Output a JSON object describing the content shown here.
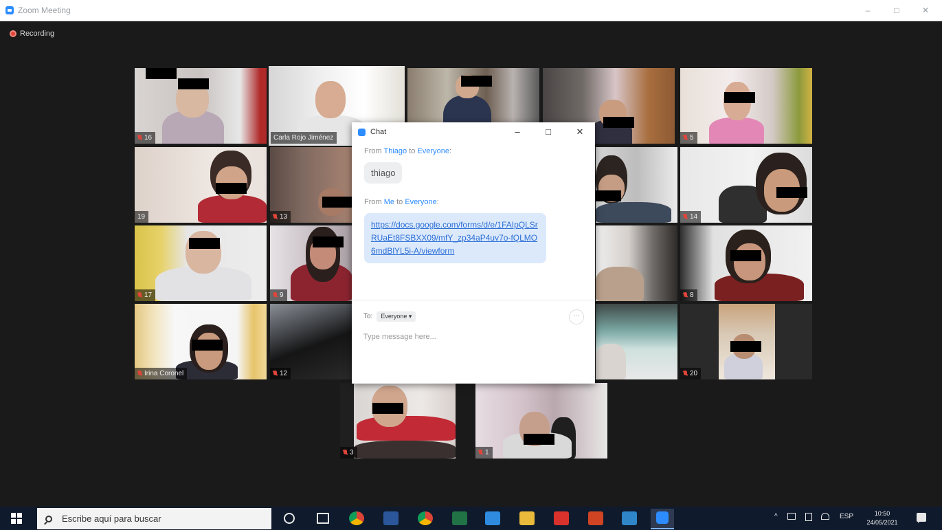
{
  "window": {
    "title": "Zoom Meeting",
    "controls": [
      "–",
      "□",
      "✕"
    ]
  },
  "recording": {
    "label": "Recording"
  },
  "tiles": [
    {
      "label": "16"
    },
    {
      "label": "Carla Rojo Jiménez",
      "active": true
    },
    {
      "label": ""
    },
    {
      "label": ""
    },
    {
      "label": "5"
    },
    {
      "label": "19"
    },
    {
      "label": "13"
    },
    {
      "label": ""
    },
    {
      "label": "14"
    },
    {
      "label": "17"
    },
    {
      "label": "9"
    },
    {
      "label": ""
    },
    {
      "label": "8"
    },
    {
      "label": "Irina Coronel"
    },
    {
      "label": "12"
    },
    {
      "label": ""
    },
    {
      "label": "20"
    },
    {
      "label": "3"
    },
    {
      "label": "1"
    }
  ],
  "chat": {
    "title": "Chat",
    "controls": [
      "–",
      "□",
      "✕"
    ],
    "messages": [
      {
        "from_prefix": "From ",
        "sender": "Thiago",
        "to_text": " to ",
        "recipient": "Everyone",
        "suffix": ":",
        "text": "thiago"
      },
      {
        "from_prefix": "From ",
        "sender": "Me",
        "to_text": " to ",
        "recipient": "Everyone",
        "suffix": ":",
        "text": "https://docs.google.com/forms/d/e/1FAIpQLSrRUaEt8FSBXX09/mfY_zp34aP4uv7o-fQLMO6mdBlYL5i-A/viewform"
      }
    ],
    "to_label": "To:",
    "to_value": "Everyone ▾",
    "more_label": "···",
    "input_placeholder": "Type message here..."
  },
  "taskbar": {
    "search_placeholder": "Escribe aquí para buscar",
    "tray": {
      "chevron": "^",
      "language": "ESP"
    },
    "clock": {
      "time": "10:50",
      "date": "24/05/2021"
    }
  }
}
